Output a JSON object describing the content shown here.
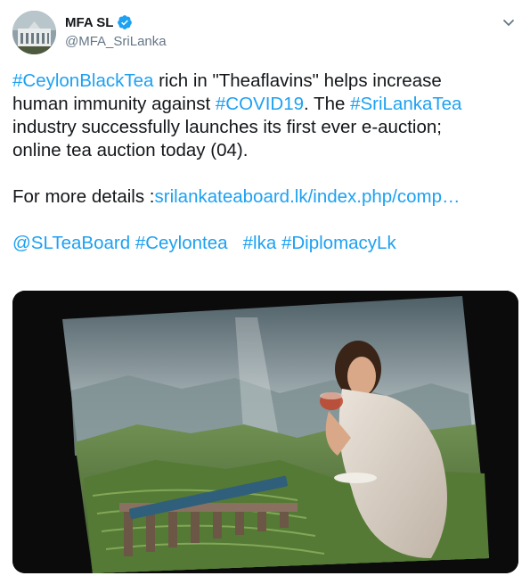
{
  "user": {
    "display_name": "MFA SL",
    "handle": "@MFA_SriLanka",
    "verified_icon": "verified-badge-icon",
    "avatar_icon": "building-avatar-icon"
  },
  "menu": {
    "icon": "chevron-down-icon"
  },
  "tweet": {
    "line1": {
      "tag1": "#CeylonBlackTea",
      "text1": " rich in \"Theaflavins\" helps increase"
    },
    "line2": {
      "text1": "human immunity against ",
      "tag1": "#COVID19",
      "text2": ". The ",
      "tag2": "#SriLankaTea"
    },
    "line3": {
      "text1": " industry successfully launches its first ever e-auction;"
    },
    "line4": {
      "text1": "online tea auction today (04)."
    },
    "line5": {
      "text1": "For more details :",
      "link": "srilankateaboard.lk/index.php/comp…"
    },
    "line6": {
      "mention": "@SLTeaBoard",
      "tag1": "#Ceylontea",
      "tag2": "#lka",
      "tag3": "#DiplomacyLk"
    }
  },
  "colors": {
    "link": "#1da1f2",
    "text": "#14171a",
    "secondary": "#657786",
    "verified": "#1da1f2"
  }
}
